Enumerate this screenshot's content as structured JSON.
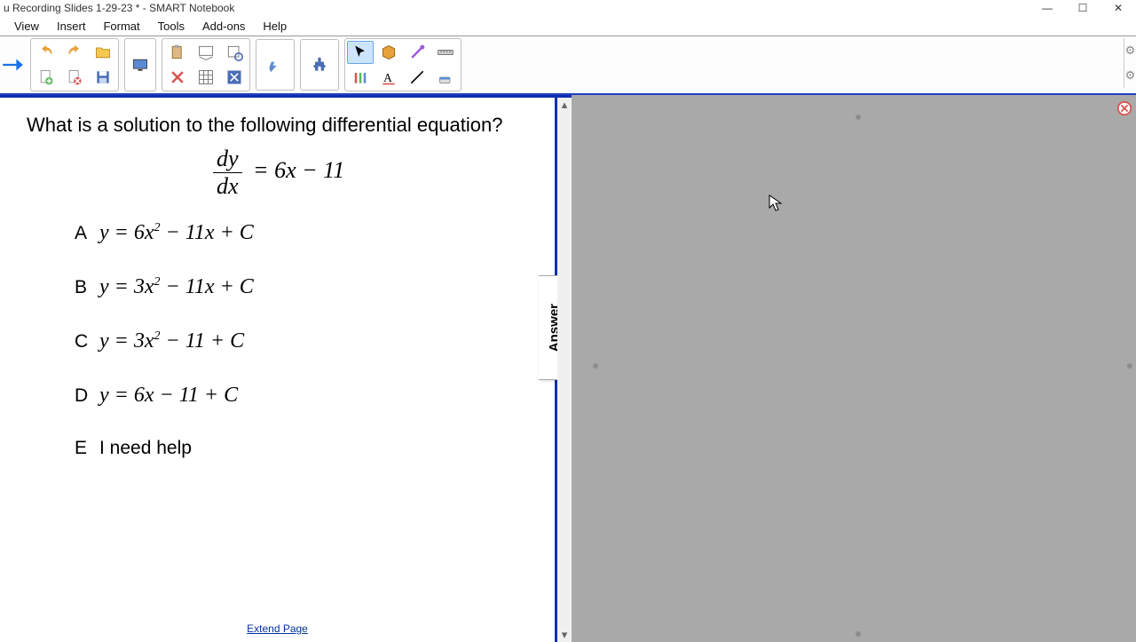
{
  "window": {
    "title": "u Recording Slides 1-29-23 * - SMART Notebook"
  },
  "menu": {
    "items": [
      "View",
      "Insert",
      "Format",
      "Tools",
      "Add-ons",
      "Help"
    ]
  },
  "toolbar": {
    "icons": {
      "nav_next": "nav-arrow-icon",
      "undo": "undo-icon",
      "redo": "redo-icon",
      "open": "open-folder-icon",
      "new_page": "new-page-icon",
      "delete_page": "delete-page-icon",
      "save": "save-icon",
      "screen": "screen-icon",
      "paste": "paste-icon",
      "slideshow": "slideshow-icon",
      "capture": "capture-icon",
      "x_red": "close-red-icon",
      "table": "table-icon",
      "math": "math-icon",
      "response": "response-icon",
      "puzzle": "puzzle-icon",
      "pointer": "pointer-icon",
      "cube": "cube-icon",
      "magic": "magic-icon",
      "measure": "measure-icon",
      "pens": "pens-icon",
      "text": "text-icon",
      "line": "line-icon",
      "eraser": "eraser-icon"
    }
  },
  "content": {
    "question": "What is a solution to the following differential equation?",
    "equation_lhs_num": "dy",
    "equation_lhs_den": "dx",
    "equation_rhs": "= 6x − 11",
    "choices": [
      {
        "letter": "A",
        "expr_html": "y = 6x<sup>2</sup> − 11x + C"
      },
      {
        "letter": "B",
        "expr_html": "y = 3x<sup>2</sup> − 11x + C"
      },
      {
        "letter": "C",
        "expr_html": "y = 3x<sup>2</sup> − 11 + C"
      },
      {
        "letter": "D",
        "expr_html": "y = 6x − 11 + C"
      },
      {
        "letter": "E",
        "expr_html": "I need help"
      }
    ],
    "answer_tab": "Answer",
    "extend": "Extend Page"
  }
}
